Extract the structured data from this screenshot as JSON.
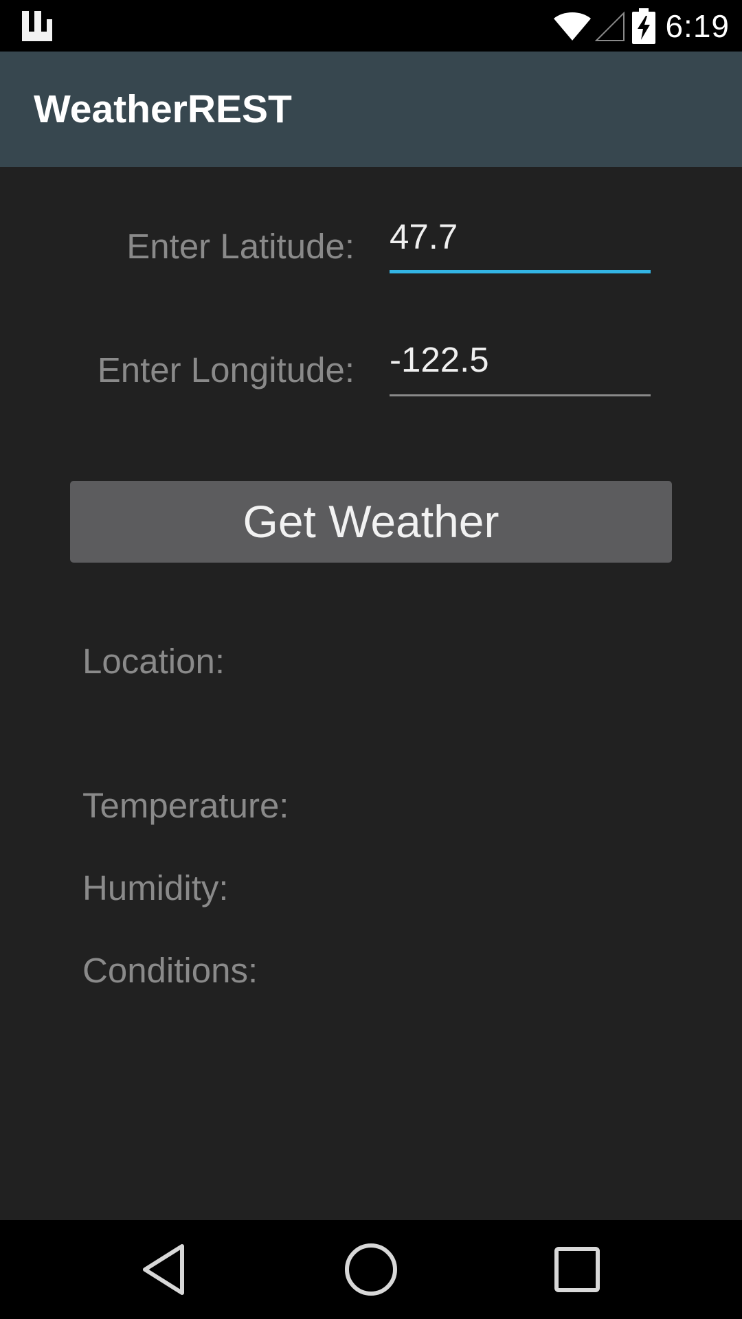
{
  "status_bar": {
    "time": "6:19",
    "left_icon": "launcher-notification-icon",
    "icons": [
      "wifi-icon",
      "cell-signal-icon",
      "battery-charging-icon"
    ]
  },
  "app_bar": {
    "title": "WeatherREST",
    "background": "#37474f"
  },
  "form": {
    "latitude_label": "Enter Latitude:",
    "latitude_value": "47.7",
    "longitude_label": "Enter Longitude:",
    "longitude_value": "-122.5",
    "active_underline_color": "#33b5e5"
  },
  "button": {
    "label": "Get Weather"
  },
  "results": {
    "location_label": "Location:",
    "temperature_label": "Temperature:",
    "humidity_label": "Humidity:",
    "conditions_label": "Conditions:"
  },
  "nav_bar": {
    "icons": [
      "back-icon",
      "home-icon",
      "recents-icon"
    ]
  }
}
